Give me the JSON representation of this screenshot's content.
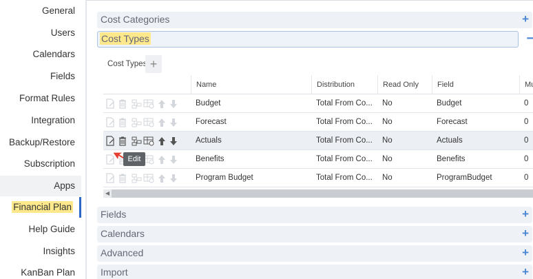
{
  "sidebar": {
    "items": [
      {
        "label": "General"
      },
      {
        "label": "Users"
      },
      {
        "label": "Calendars"
      },
      {
        "label": "Fields"
      },
      {
        "label": "Format Rules"
      },
      {
        "label": "Integration"
      },
      {
        "label": "Backup/Restore"
      },
      {
        "label": "Subscription"
      },
      {
        "label": "Apps"
      },
      {
        "label": "Financial Plan"
      },
      {
        "label": "Help Guide"
      },
      {
        "label": "Insights"
      },
      {
        "label": "KanBan Plan"
      }
    ]
  },
  "sections": {
    "cost_categories": "Cost Categories",
    "cost_types": "Cost Types",
    "fields": "Fields",
    "calendars": "Calendars",
    "advanced": "Advanced",
    "import": "Import"
  },
  "cost_types_toolbar": {
    "label": "Cost Types",
    "add_symbol": "+"
  },
  "table": {
    "columns": [
      "Name",
      "Distribution",
      "Read Only",
      "Field",
      "Mu"
    ],
    "rows": [
      {
        "name": "Budget",
        "distribution": "Total From Co...",
        "read_only": "No",
        "field": "Budget",
        "mu": "0"
      },
      {
        "name": "Forecast",
        "distribution": "Total From Co...",
        "read_only": "No",
        "field": "Forecast",
        "mu": "0"
      },
      {
        "name": "Actuals",
        "distribution": "Total From Co...",
        "read_only": "No",
        "field": "Actuals",
        "mu": "0"
      },
      {
        "name": "Benefits",
        "distribution": "Total From Co...",
        "read_only": "No",
        "field": "Benefits",
        "mu": "0"
      },
      {
        "name": "Program Budget",
        "distribution": "Total From Co...",
        "read_only": "No",
        "field": "ProgramBudget",
        "mu": "0"
      }
    ]
  },
  "tooltip": "Edit",
  "icons": [
    "edit-icon",
    "delete-icon",
    "hierarchy-icon",
    "settings-table-icon",
    "move-up-icon",
    "move-down-icon"
  ],
  "colors": {
    "accent": "#4a86d4",
    "highlight": "#fde98c",
    "active_border": "#2a67c9"
  }
}
